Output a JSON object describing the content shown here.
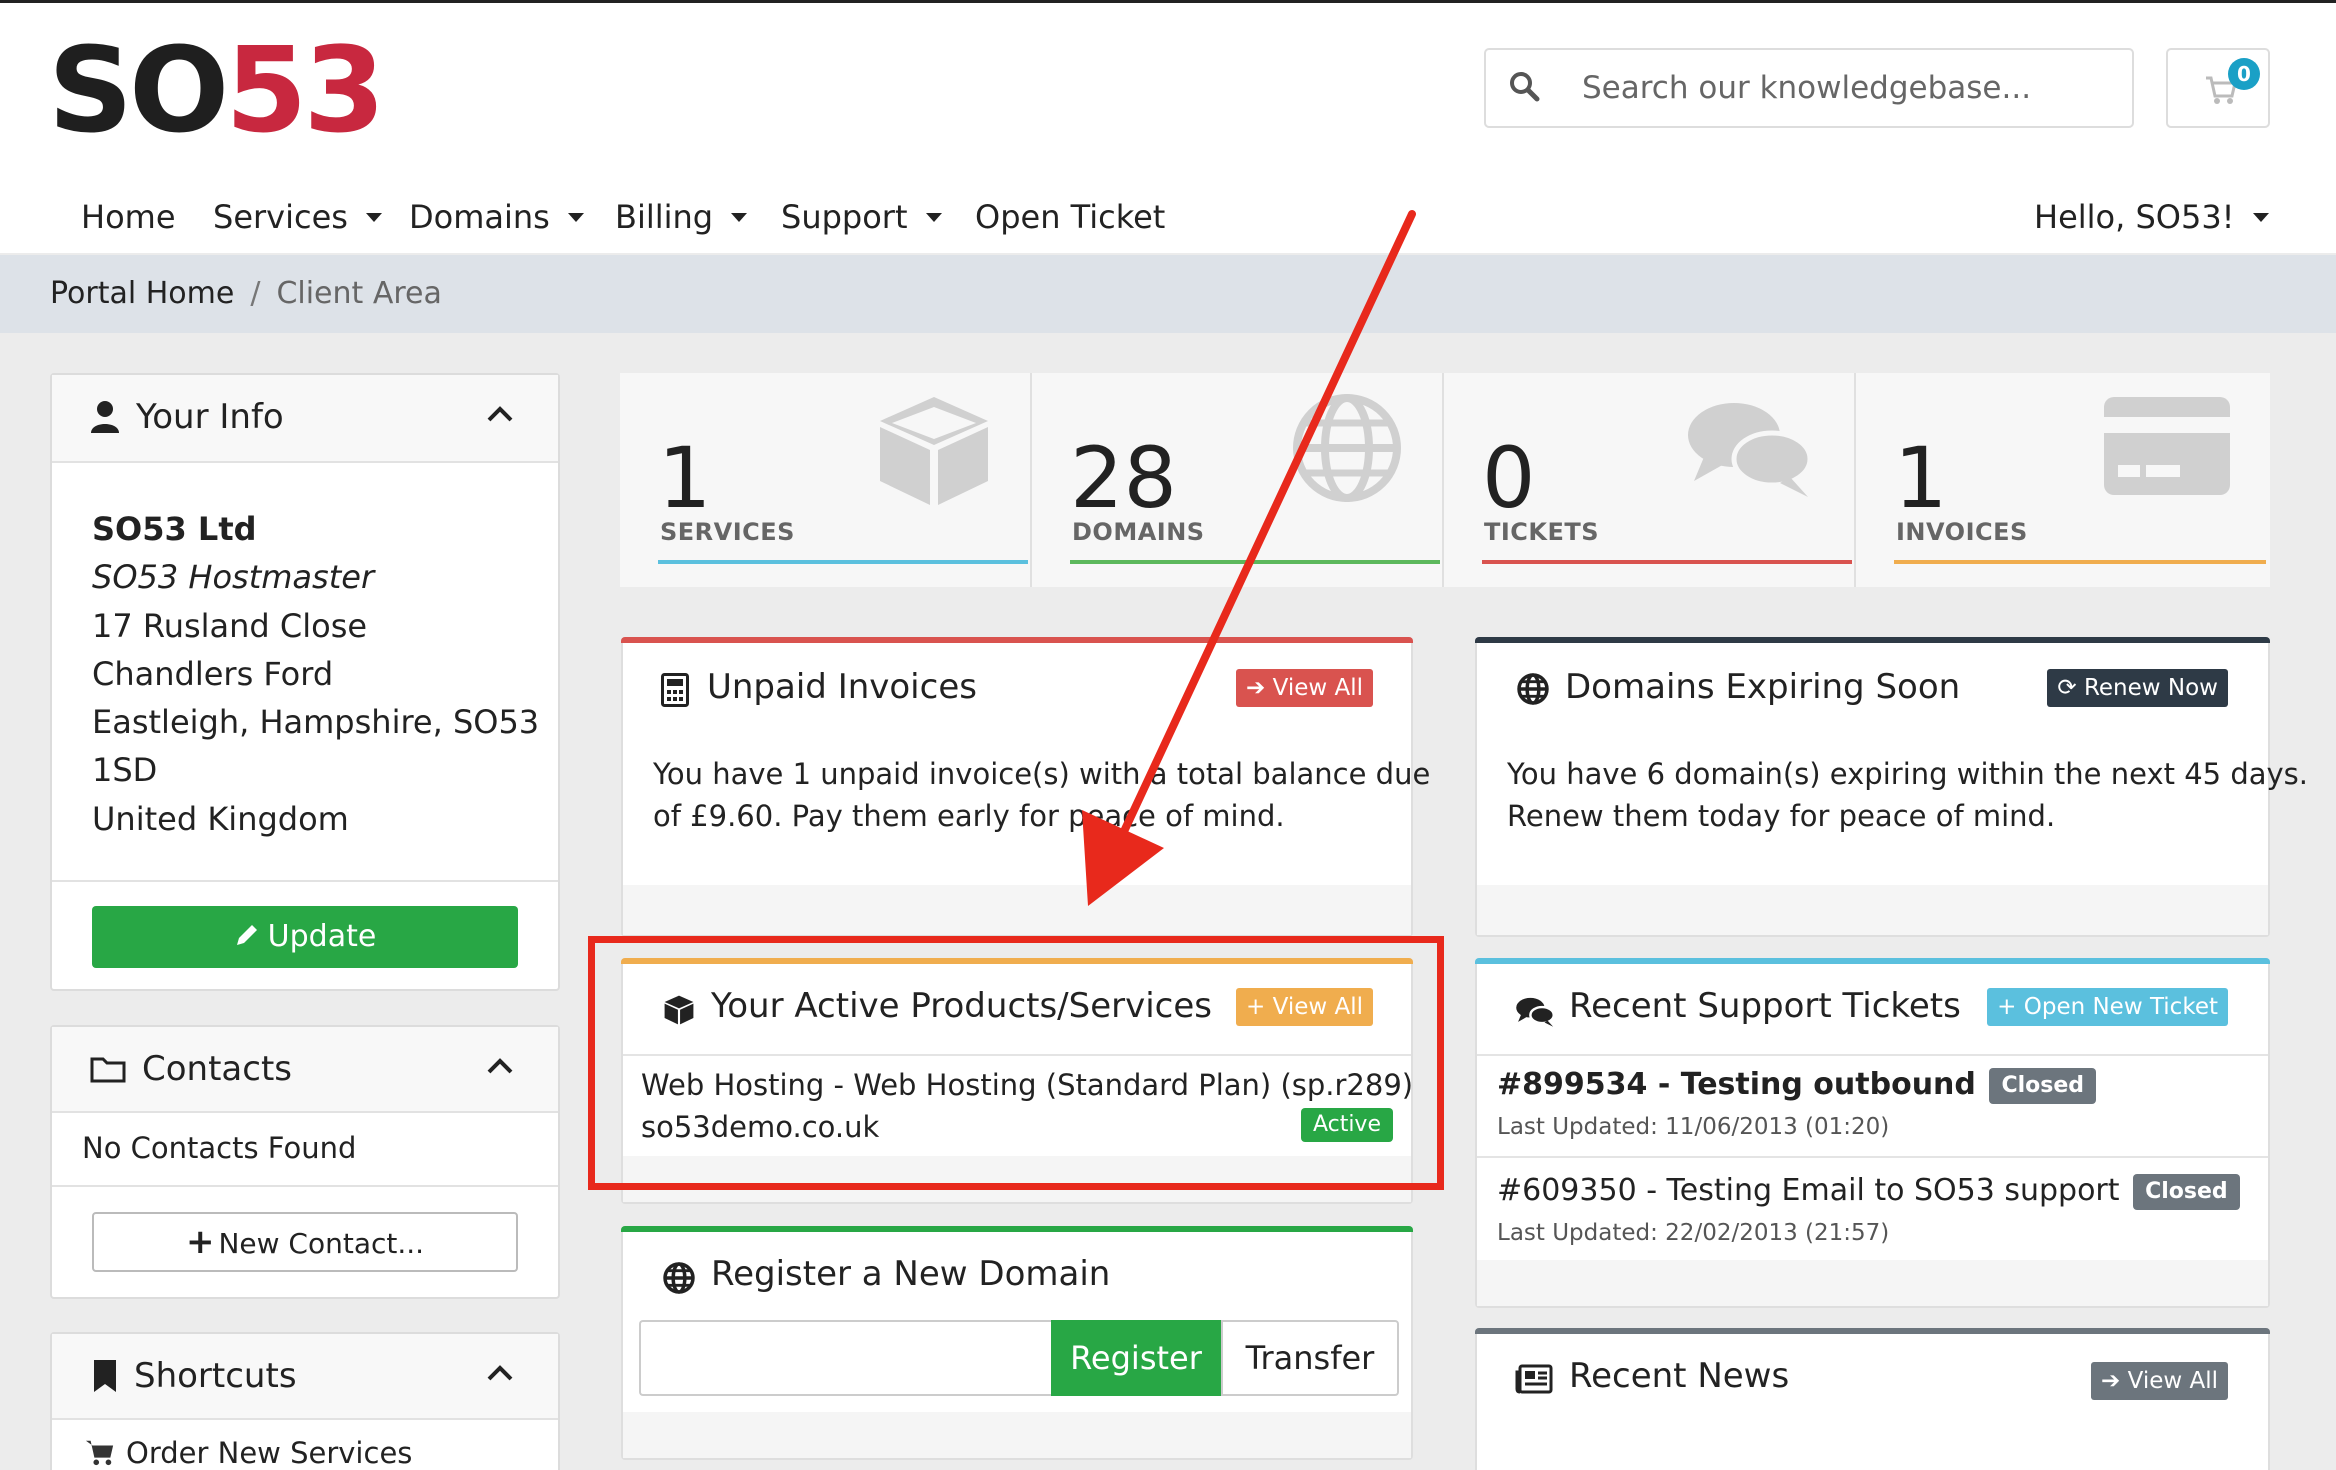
{
  "brand": {
    "logo_left": "SO",
    "logo_right": "53"
  },
  "search": {
    "placeholder": "Search our knowledgebase..."
  },
  "cart": {
    "count": "0"
  },
  "nav": {
    "items": [
      "Home",
      "Services",
      "Domains",
      "Billing",
      "Support",
      "Open Ticket"
    ],
    "user": "Hello, SO53!"
  },
  "breadcrumb": {
    "home": "Portal Home",
    "current": "Client Area"
  },
  "your_info": {
    "title": "Your Info",
    "company": "SO53 Ltd",
    "name": "SO53 Hostmaster",
    "address1": "17 Rusland Close",
    "address2": "Chandlers Ford",
    "address3": "Eastleigh, Hampshire, SO53",
    "address4": "1SD",
    "country": "United Kingdom",
    "update_label": "Update"
  },
  "contacts": {
    "title": "Contacts",
    "empty": "No Contacts Found",
    "new_label": "New Contact..."
  },
  "shortcuts": {
    "title": "Shortcuts",
    "item1": "Order New Services"
  },
  "stats": [
    {
      "value": "1",
      "label": "SERVICES",
      "color": "#5bc0de"
    },
    {
      "value": "28",
      "label": "DOMAINS",
      "color": "#5cb85c"
    },
    {
      "value": "0",
      "label": "TICKETS",
      "color": "#d9534f"
    },
    {
      "value": "1",
      "label": "INVOICES",
      "color": "#f0ad4e"
    }
  ],
  "unpaid": {
    "title": "Unpaid Invoices",
    "btn": "View All",
    "line1": "You have 1 unpaid invoice(s) with a total balance due",
    "line2": "of £9.60. Pay them early for peace of mind."
  },
  "expiring": {
    "title": "Domains Expiring Soon",
    "btn": "Renew Now",
    "line1": "You have 6 domain(s) expiring within the next 45 days.",
    "line2": "Renew them today for peace of mind."
  },
  "products": {
    "title": "Your Active Products/Services",
    "btn": "View All",
    "item_name": "Web Hosting - Web Hosting (Standard Plan) (sp.r289)",
    "item_domain": "so53demo.co.uk",
    "item_status": "Active"
  },
  "tickets": {
    "title": "Recent Support Tickets",
    "btn": "Open New Ticket",
    "t1_title": "#899534 - Testing outbound",
    "t1_status": "Closed",
    "t1_updated": "Last Updated: 11/06/2013 (01:20)",
    "t2_title": "#609350 - Testing Email to SO53 support",
    "t2_status": "Closed",
    "t2_updated": "Last Updated: 22/02/2013 (21:57)"
  },
  "register": {
    "title": "Register a New Domain",
    "register_label": "Register",
    "transfer_label": "Transfer"
  },
  "news": {
    "title": "Recent News",
    "btn": "View All"
  },
  "colors": {
    "green": "#28a745",
    "red": "#d9534f",
    "orange": "#f0ad4e",
    "info": "#5bc0de",
    "dark": "#2e3a46",
    "gray": "#6c757d",
    "annotation": "#e8291c"
  }
}
